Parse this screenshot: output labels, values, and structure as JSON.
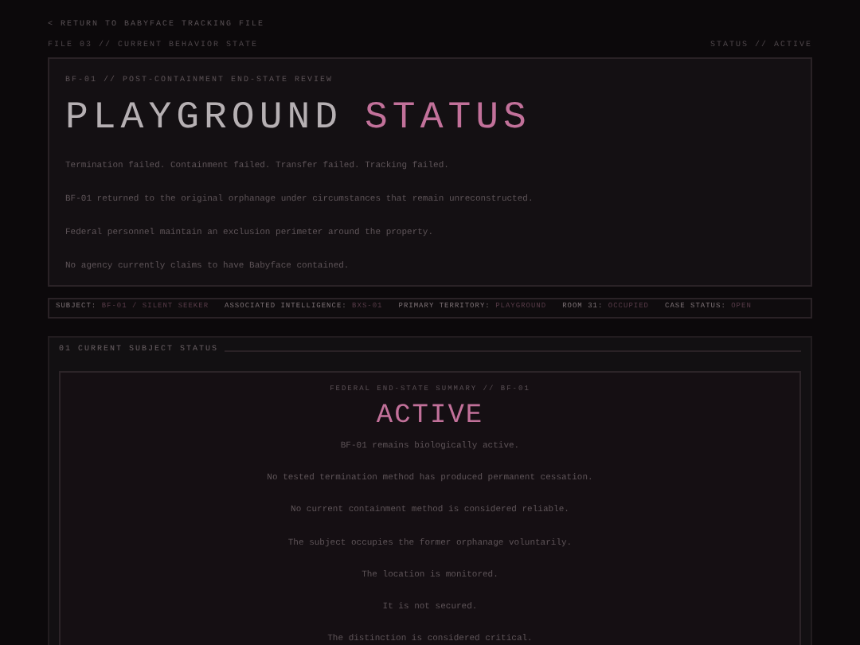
{
  "nav": {
    "back_link": "< RETURN TO BABYFACE TRACKING FILE",
    "file_label": "FILE 03 // CURRENT BEHAVIOR STATE",
    "status_label": "STATUS // ACTIVE"
  },
  "header": {
    "eyebrow": "BF-01 // POST-CONTAINMENT END-STATE REVIEW",
    "title_part_1": "PLAYGROUND",
    "title_part_2": "STATUS",
    "lines": [
      "Termination failed. Containment failed. Transfer failed. Tracking failed.",
      "BF-01 returned to the original orphanage under circumstances that remain unreconstructed.",
      "Federal personnel maintain an exclusion perimeter around the property.",
      "No agency currently claims to have Babyface contained."
    ]
  },
  "meta": [
    {
      "label": "SUBJECT:",
      "value": "BF-01 / SILENT SEEKER"
    },
    {
      "label": "ASSOCIATED INTELLIGENCE:",
      "value": "BXS-01"
    },
    {
      "label": "PRIMARY TERRITORY:",
      "value": "PLAYGROUND"
    },
    {
      "label": "ROOM 31:",
      "value": "OCCUPIED"
    },
    {
      "label": "CASE STATUS:",
      "value": "OPEN"
    }
  ],
  "section": {
    "number": "01",
    "title": "CURRENT SUBJECT STATUS",
    "summary_label": "FEDERAL END-STATE SUMMARY // BF-01",
    "status": "ACTIVE",
    "lines": [
      "BF-01 remains biologically active.",
      "No tested termination method has produced permanent cessation.",
      "No current containment method is considered reliable.",
      "The subject occupies the former orphanage voluntarily.",
      "The location is monitored.",
      "It is not secured.",
      "The distinction is considered critical."
    ]
  }
}
